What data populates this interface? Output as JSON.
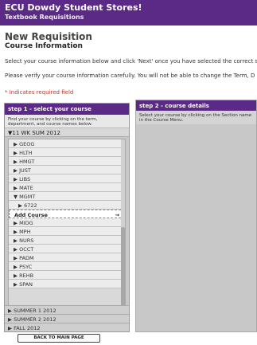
{
  "header": {
    "title": "ECU Dowdy Student Stores!",
    "subtitle": "Textbook Requisitions"
  },
  "page": {
    "title": "New Requisition",
    "subtitle": "Course Information",
    "instruction1": "Select your course information below and click 'Next' once you have selected the correct s",
    "instruction2": "Please verify your course information carefully. You will not be able to change the Term, D",
    "required_note": "* Indicates required field"
  },
  "step1": {
    "heading": "step 1 - select your course",
    "description": "Find your course by clicking on the term, department, and course names below.",
    "open_term": "▼11 WK SUM 2012",
    "departments": [
      "GEOG",
      "HLTH",
      "HMGT",
      "JUST",
      "LIBS",
      "MATE"
    ],
    "expanded_department": "MGMT",
    "course": "6722",
    "add_course": "Add Course",
    "add_arrow": "→",
    "departments_after": [
      "MIDG",
      "MPH",
      "NURS",
      "OCCT",
      "PADM",
      "PSYC",
      "REHB",
      "SPAN"
    ],
    "other_terms": [
      "SUMMER 1 2012",
      "SUMMER 2 2012",
      "FALL 2012"
    ]
  },
  "step2": {
    "heading": "step 2 - course details",
    "description": "Select your course by clicking on the Section name in the Course Menu."
  },
  "back_button": "BACK TO MAIN PAGE"
}
